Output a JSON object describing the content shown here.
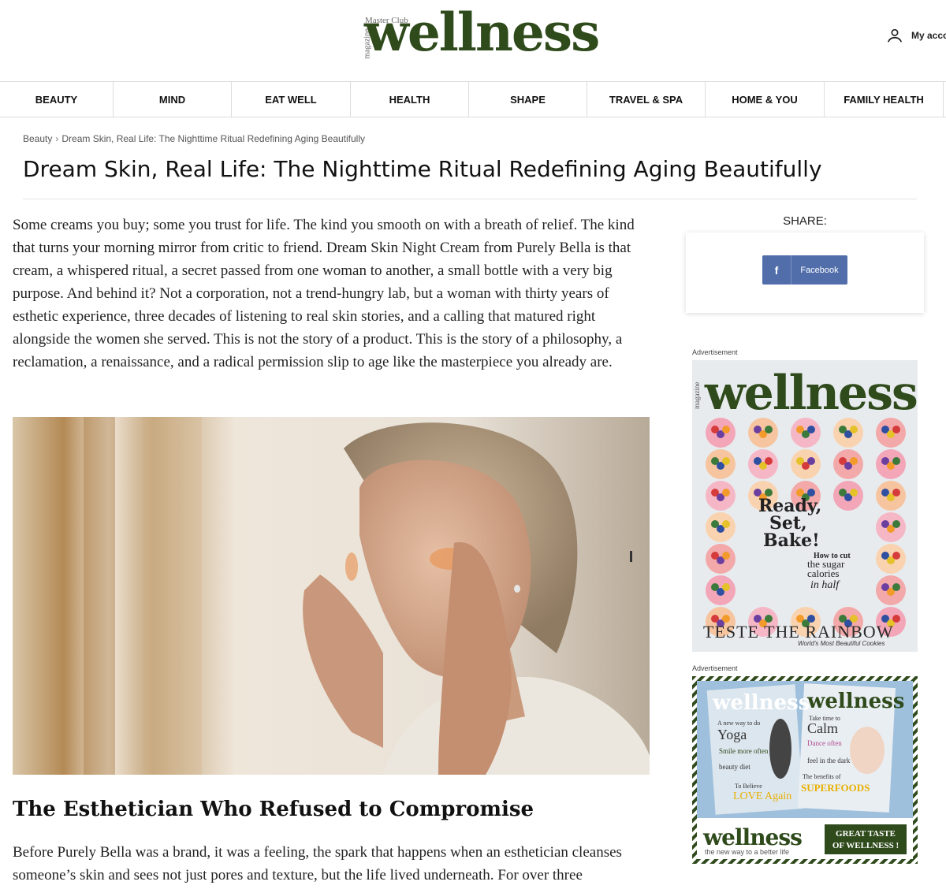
{
  "header": {
    "logo_top": "Master Club",
    "logo_side": "magazine",
    "logo_word": "wellness",
    "account_label": "My acco"
  },
  "nav": {
    "items": [
      "BEAUTY",
      "MIND",
      "EAT WELL",
      "HEALTH",
      "SHAPE",
      "TRAVEL & SPA",
      "HOME & YOU",
      "FAMILY HEALTH"
    ]
  },
  "breadcrumb": {
    "root": "Beauty",
    "separator": "›",
    "current": "Dream Skin, Real Life: The Nighttime Ritual Redefining Aging Beautifully"
  },
  "article": {
    "title": "Dream Skin, Real Life: The Nighttime Ritual Redefining Aging Beautifully",
    "intro": "Some creams you buy; some you trust for life. The kind you smooth on with a breath of relief. The kind that turns your morning mirror from critic to friend. Dream Skin Night Cream from Purely Bella is that cream, a whispered ritual, a secret passed from one woman to another, a small bottle with a very big purpose. And behind it? Not a corporation, not a trend-hungry lab, but a woman with thirty years of esthetic experience, three decades of listening to real skin stories, and a calling that matured right alongside the women she served. This is not the story of a product. This is the story of a philosophy, a reclamation, a renaissance, and a radical permission slip to age like the masterpiece you already are.",
    "section_heading": "The Esthetician Who Refused to Compromise",
    "section_text": "Before Purely Bella was a brand, it was a feeling, the spark that happens when an esthetician cleanses someone’s skin and sees not just pores and texture, but the life lived underneath. For over three"
  },
  "sidebar": {
    "share_label": "SHARE:",
    "facebook_label": "Facebook",
    "ad_label": "Advertisement",
    "ad1": {
      "masthead": "wellness",
      "side": "magazine",
      "headline": [
        "Ready,",
        "Set,",
        "Bake!"
      ],
      "subhead": [
        "How to cut",
        "the sugar",
        "calories",
        "in half"
      ],
      "banner": "TESTE THE RAINBOW",
      "tagline": "World's Most Beautiful Cookies"
    },
    "ad2": {
      "cover_left": "wellness",
      "cover_left_lines": [
        "A new way to do",
        "Yoga",
        "Smile more often",
        "beauty diet",
        "To Believe",
        "LOVE Again"
      ],
      "cover_right": "wellness",
      "cover_right_lines": [
        "Take time to",
        "Calm",
        "Dance often",
        "feel in the dark",
        "The benefits of",
        "SUPERFOODS"
      ],
      "brand": "wellness",
      "brand_tagline": "the new way to a better life",
      "cta": "GREAT TASTE OF WELLNESS !"
    }
  },
  "colors": {
    "brand_green": "#2f4a1b",
    "facebook": "#516eab",
    "cta_green": "#2f4a1b"
  }
}
